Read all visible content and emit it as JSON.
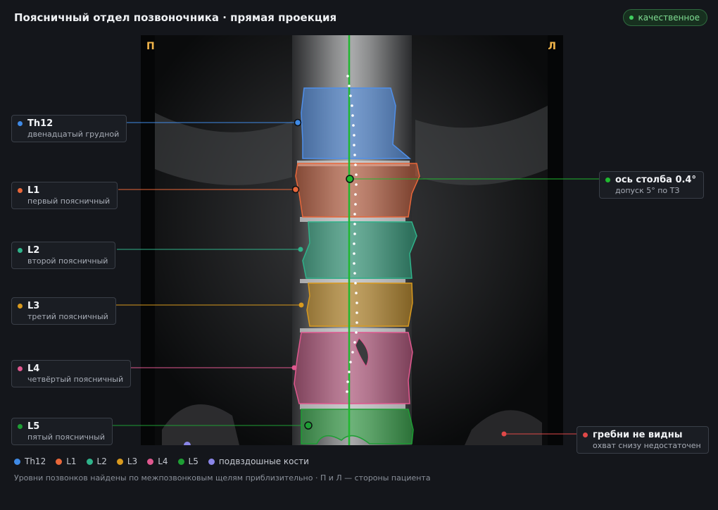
{
  "header": {
    "title": "Поясничный отдел позвоночника · прямая проекция",
    "quality_label": "качественное"
  },
  "image": {
    "side_right": "П",
    "side_left": "Л"
  },
  "vertebrae": [
    {
      "key": "th12",
      "name": "Th12",
      "desc": "двенадцатый грудной",
      "color": "#3f8ae6"
    },
    {
      "key": "l1",
      "name": "L1",
      "desc": "первый поясничный",
      "color": "#e8673a"
    },
    {
      "key": "l2",
      "name": "L2",
      "desc": "второй поясничный",
      "color": "#2fb38a"
    },
    {
      "key": "l3",
      "name": "L3",
      "desc": "третий поясничный",
      "color": "#d99a1e"
    },
    {
      "key": "l4",
      "name": "L4",
      "desc": "четвёртый поясничный",
      "color": "#e0588f"
    },
    {
      "key": "l5",
      "name": "L5",
      "desc": "пятый поясничный",
      "color": "#1e9e34"
    }
  ],
  "axis": {
    "name": "ось столба 0.4°",
    "desc": "допуск 5° по ТЗ",
    "color": "#1fb82f"
  },
  "crests": {
    "name": "гребни не видны",
    "desc": "охват снизу недостаточен",
    "color": "#e04848"
  },
  "legend": [
    {
      "label": "Th12",
      "color": "#3f8ae6"
    },
    {
      "label": "L1",
      "color": "#e8673a"
    },
    {
      "label": "L2",
      "color": "#2fb38a"
    },
    {
      "label": "L3",
      "color": "#d99a1e"
    },
    {
      "label": "L4",
      "color": "#e0588f"
    },
    {
      "label": "L5",
      "color": "#1e9e34"
    },
    {
      "label": "подвздошные кости",
      "color": "#8a86e8"
    }
  ],
  "footnote": "Уровни позвонков найдены по межпозвонковым щелям приблизительно · П и Л — стороны пациента"
}
